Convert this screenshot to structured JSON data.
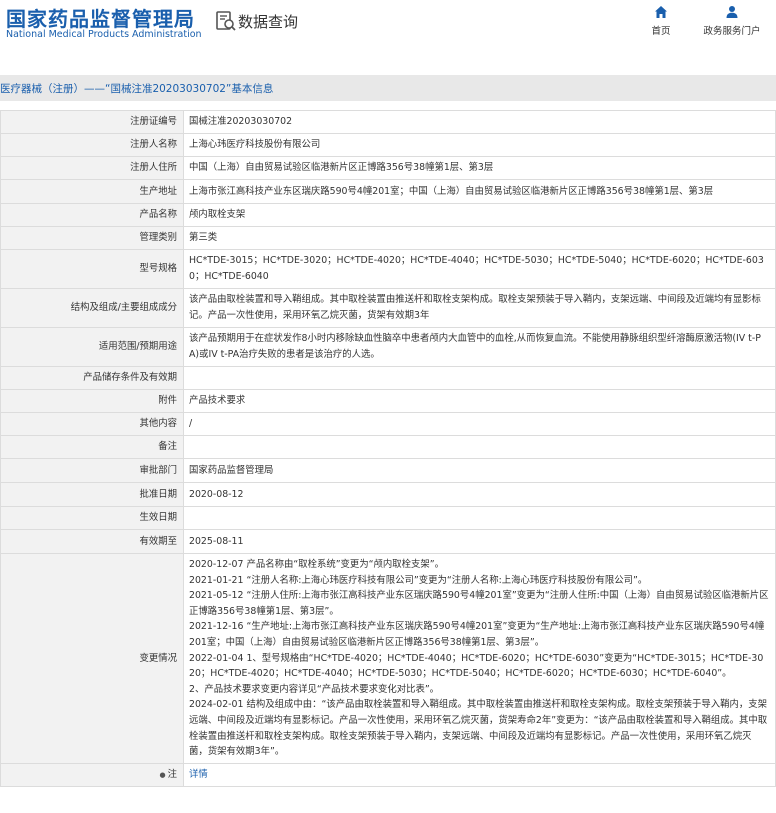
{
  "header": {
    "logo_cn": "国家药品监督管理局",
    "logo_en": "National Medical Products Administration",
    "query_title": "数据查询",
    "nav": [
      {
        "label": "首页",
        "icon": "home-icon"
      },
      {
        "label": "政务服务门户",
        "icon": "user-icon"
      }
    ]
  },
  "breadcrumb": "医疗器械（注册）——“国械注准20203030702”基本信息",
  "colors": {
    "brand": "#1a5fad",
    "label_bg": "#f2f2f2",
    "crumb_bg": "#e8e8e8"
  },
  "rows": [
    {
      "label": "注册证编号",
      "value": "国械注准20203030702"
    },
    {
      "label": "注册人名称",
      "value": "上海心玮医疗科技股份有限公司"
    },
    {
      "label": "注册人住所",
      "value": "中国（上海）自由贸易试验区临港新片区正博路356号38幢第1层、第3层"
    },
    {
      "label": "生产地址",
      "value": "上海市张江高科技产业东区瑞庆路590号4幢201室；中国（上海）自由贸易试验区临港新片区正博路356号38幢第1层、第3层"
    },
    {
      "label": "产品名称",
      "value": "颅内取栓支架"
    },
    {
      "label": "管理类别",
      "value": "第三类"
    },
    {
      "label": "型号规格",
      "value": "HC*TDE-3015；HC*TDE-3020；HC*TDE-4020；HC*TDE-4040；HC*TDE-5030；HC*TDE-5040；HC*TDE-6020；HC*TDE-6030；HC*TDE-6040"
    },
    {
      "label": "结构及组成/主要组成成分",
      "value": "该产品由取栓装置和导入鞘组成。其中取栓装置由推送杆和取栓支架构成。取栓支架预装于导入鞘内，支架远端、中间段及近端均有显影标记。产品一次性使用，采用环氧乙烷灭菌，货架有效期3年"
    },
    {
      "label": "适用范围/预期用途",
      "value": "该产品预期用于在症状发作8小时内移除缺血性脑卒中患者颅内大血管中的血栓,从而恢复血流。不能使用静脉组织型纤溶酶原激活物(IV t-PA)或IV t-PA治疗失败的患者是该治疗的人选。"
    },
    {
      "label": "产品储存条件及有效期",
      "value": ""
    },
    {
      "label": "附件",
      "value": "产品技术要求"
    },
    {
      "label": "其他内容",
      "value": "/"
    },
    {
      "label": "备注",
      "value": ""
    },
    {
      "label": "审批部门",
      "value": "国家药品监督管理局"
    },
    {
      "label": "批准日期",
      "value": "2020-08-12"
    },
    {
      "label": "生效日期",
      "value": ""
    },
    {
      "label": "有效期至",
      "value": "2025-08-11"
    }
  ],
  "changes": {
    "label": "变更情况",
    "lines": [
      "2020-12-07 产品名称由“取栓系统”变更为“颅内取栓支架”。",
      "2021-01-21 “注册人名称:上海心玮医疗科技有限公司”变更为“注册人名称:上海心玮医疗科技股份有限公司”。",
      "2021-05-12 “注册人住所:上海市张江高科技产业东区瑞庆路590号4幢201室”变更为“注册人住所:中国（上海）自由贸易试验区临港新片区正博路356号38幢第1层、第3层”。",
      "2021-12-16 “生产地址:上海市张江高科技产业东区瑞庆路590号4幢201室”变更为“生产地址:上海市张江高科技产业东区瑞庆路590号4幢201室；中国（上海）自由贸易试验区临港新片区正博路356号38幢第1层、第3层”。",
      "2022-01-04 1、型号规格由“HC*TDE-4020；HC*TDE-4040；HC*TDE-6020；HC*TDE-6030”变更为“HC*TDE-3015；HC*TDE-3020；HC*TDE-4020；HC*TDE-4040；HC*TDE-5030；HC*TDE-5040；HC*TDE-6020；HC*TDE-6030；HC*TDE-6040”。",
      "2、产品技术要求变更内容详见“产品技术要求变化对比表”。",
      "2024-02-01 结构及组成中由：“该产品由取栓装置和导入鞘组成。其中取栓装置由推送杆和取栓支架构成。取栓支架预装于导入鞘内，支架远端、中间段及近端均有显影标记。产品一次性使用，采用环氧乙烷灭菌，货架寿命2年”变更为：“该产品由取栓装置和导入鞘组成。其中取栓装置由推送杆和取栓支架构成。取栓支架预装于导入鞘内，支架远端、中间段及近端均有显影标记。产品一次性使用，采用环氧乙烷灭菌，货架有效期3年”。"
    ]
  },
  "note": {
    "label": "注",
    "icon": "note-icon",
    "link": "详情"
  }
}
